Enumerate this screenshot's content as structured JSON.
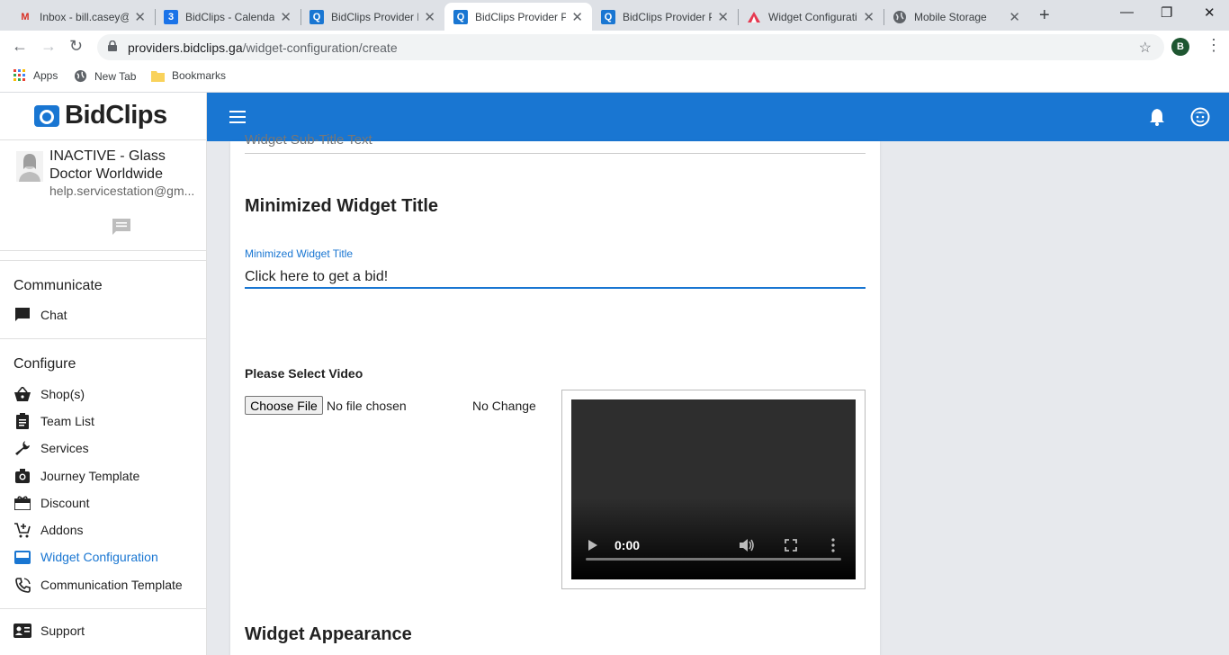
{
  "browser": {
    "tabs": [
      {
        "title": "Inbox - bill.casey@",
        "icon": "gmail-icon",
        "active": false
      },
      {
        "title": "BidClips - Calenda",
        "icon": "calendar-icon",
        "active": false
      },
      {
        "title": "BidClips Provider P",
        "icon": "bidclips-icon",
        "active": false
      },
      {
        "title": "BidClips Provider P",
        "icon": "bidclips-icon",
        "active": true
      },
      {
        "title": "BidClips Provider P",
        "icon": "bidclips-icon",
        "active": false
      },
      {
        "title": "Widget Configurati",
        "icon": "widget-icon",
        "active": false
      },
      {
        "title": "Mobile Storage",
        "icon": "globe-icon",
        "active": false
      }
    ],
    "new_tab": "+",
    "url_host": "providers.bidclips.ga",
    "url_path": "/widget-configuration/create",
    "profile_initial": "B",
    "bookmarks": [
      {
        "label": "Apps",
        "icon": "apps-grid-icon"
      },
      {
        "label": "New Tab",
        "icon": "globe-icon"
      },
      {
        "label": "Bookmarks",
        "icon": "folder-icon"
      }
    ]
  },
  "sidebar": {
    "logo": "BidClips",
    "account_name": "INACTIVE - Glass Doctor Worldwide",
    "account_email": "help.servicestation@gm...",
    "sections": [
      {
        "heading": "Communicate",
        "items": [
          {
            "label": "Chat",
            "icon": "chat-icon"
          }
        ]
      },
      {
        "heading": "Configure",
        "items": [
          {
            "label": "Shop(s)",
            "icon": "basket-icon"
          },
          {
            "label": "Team List",
            "icon": "clipboard-icon"
          },
          {
            "label": "Services",
            "icon": "wrench-icon"
          },
          {
            "label": "Journey Template",
            "icon": "camera-icon"
          },
          {
            "label": "Discount",
            "icon": "gift-icon"
          },
          {
            "label": "Addons",
            "icon": "cart-plus-icon"
          },
          {
            "label": "Widget Configuration",
            "icon": "widget-icon",
            "active": true
          },
          {
            "label": "Communication Template",
            "icon": "phone-icon"
          }
        ]
      }
    ],
    "support": {
      "label": "Support",
      "icon": "contact-card-icon"
    }
  },
  "form": {
    "prev_field_text": "Widget Sub-Title Text",
    "minimized_section_title": "Minimized Widget Title",
    "minimized_field_label": "Minimized Widget Title",
    "minimized_field_value": "Click here to get a bid!",
    "select_video_label": "Please Select Video",
    "choose_file_label": "Choose File",
    "file_status": "No file chosen",
    "no_change": "No Change",
    "video_time": "0:00",
    "appearance_title": "Widget Appearance"
  },
  "colors": {
    "accent": "#1976d2",
    "content_bg": "#e7e9ed"
  }
}
